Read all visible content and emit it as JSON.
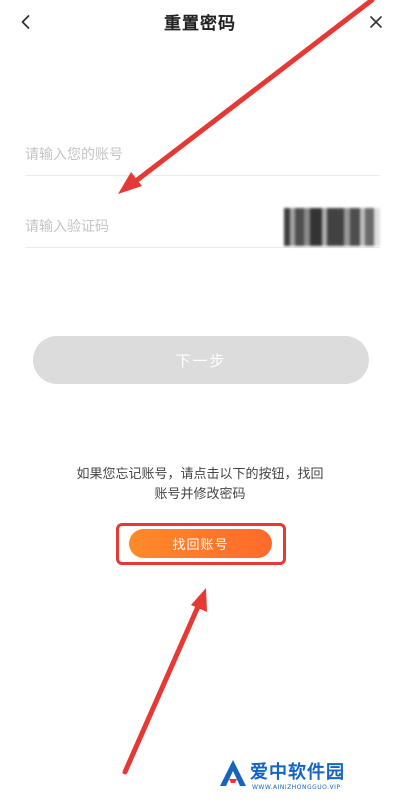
{
  "header": {
    "back_icon": "chevron-left-icon",
    "title": "重置密码",
    "close_icon": "close-icon"
  },
  "form": {
    "account_placeholder": "请输入您的账号",
    "account_value": "",
    "code_placeholder": "请输入验证码",
    "code_value": "",
    "next_label": "下一步"
  },
  "recovery": {
    "hint_line1": "如果您忘记账号，请点击以下的按钮，找回",
    "hint_line2": "账号并修改密码",
    "button_label": "找回账号"
  },
  "watermark": {
    "logo_icon": "letter-a-logo",
    "title": "爱中软件园",
    "url": "WWW.AINIZHONGGUO.VIP"
  },
  "colors": {
    "accent_orange": "#ff7a2a",
    "annotation_red": "#e53935",
    "disabled_gray": "#dcdcdc",
    "watermark_blue": "#1565c0"
  }
}
